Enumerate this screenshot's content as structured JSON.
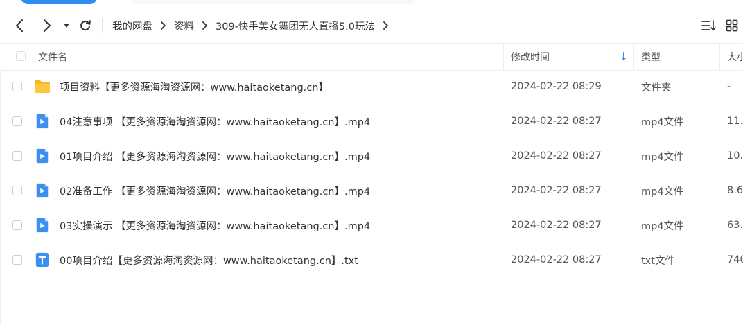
{
  "breadcrumb": [
    "我的网盘",
    "资料",
    "309-快手美女舞团无人直播5.0玩法"
  ],
  "columns": {
    "name": "文件名",
    "modified": "修改时间",
    "type": "类型",
    "size": "大小"
  },
  "sort": {
    "column": "modified",
    "direction": "descending",
    "icon": "arrow-down-icon"
  },
  "accent_color": "#2f8cf2",
  "files": [
    {
      "icon": "folder-icon",
      "name": "项目资料【更多资源海淘资源网：www.haitaoketang.cn】",
      "modified": "2024-02-22 08:29",
      "type": "文件夹",
      "size": "-"
    },
    {
      "icon": "video-file-icon",
      "name": "04注意事项 【更多资源海淘资源网：www.haitaoketang.cn】.mp4",
      "modified": "2024-02-22 08:27",
      "type": "mp4文件",
      "size": "11."
    },
    {
      "icon": "video-file-icon",
      "name": "01项目介绍 【更多资源海淘资源网：www.haitaoketang.cn】.mp4",
      "modified": "2024-02-22 08:27",
      "type": "mp4文件",
      "size": "10."
    },
    {
      "icon": "video-file-icon",
      "name": "02准备工作 【更多资源海淘资源网：www.haitaoketang.cn】.mp4",
      "modified": "2024-02-22 08:27",
      "type": "mp4文件",
      "size": "8.6"
    },
    {
      "icon": "video-file-icon",
      "name": "03实操演示 【更多资源海淘资源网：www.haitaoketang.cn】.mp4",
      "modified": "2024-02-22 08:27",
      "type": "mp4文件",
      "size": "63."
    },
    {
      "icon": "text-file-icon",
      "name": "00项目介绍【更多资源海淘资源网：www.haitaoketang.cn】.txt",
      "modified": "2024-02-22 08:27",
      "type": "txt文件",
      "size": "740"
    }
  ]
}
